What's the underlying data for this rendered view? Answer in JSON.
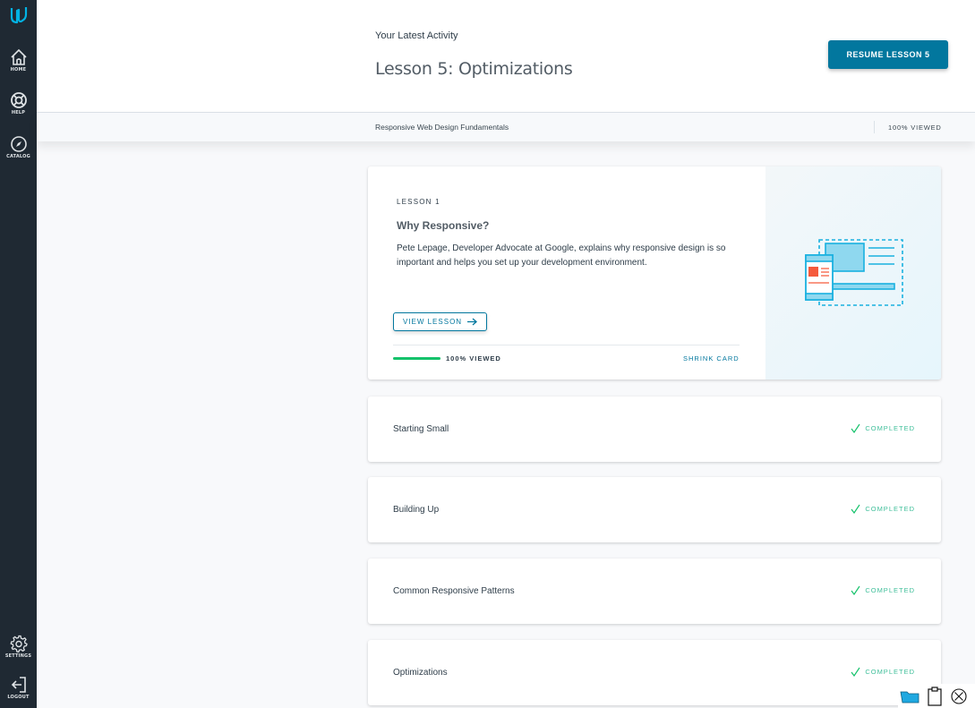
{
  "sidebar": {
    "logo": "udacity-logo-icon",
    "items": [
      {
        "label": "HOME",
        "icon": "home-icon"
      },
      {
        "label": "HELP",
        "icon": "lifebuoy-icon"
      },
      {
        "label": "CATALOG",
        "icon": "compass-icon"
      }
    ],
    "bottom_items": [
      {
        "label": "SETTINGS",
        "icon": "gear-icon"
      },
      {
        "label": "LOGOUT",
        "icon": "logout-icon"
      }
    ]
  },
  "header": {
    "latest_label": "Your Latest Activity",
    "lesson_title": "Lesson 5: Optimizations",
    "resume_button": "RESUME LESSON 5"
  },
  "subbar": {
    "course_name": "Responsive Web Design Fundamentals",
    "viewed": "100% VIEWED"
  },
  "featured_card": {
    "lesson_number": "LESSON 1",
    "title": "Why Responsive?",
    "description": "Pete Lepage, Developer Advocate at Google, explains why responsive design is so important and helps you set up your development environment.",
    "view_button": "VIEW LESSON",
    "progress_percent": 100,
    "viewed": "100% VIEWED",
    "shrink": "SHRINK CARD"
  },
  "lessons": [
    {
      "title": "Starting Small",
      "status": "COMPLETED"
    },
    {
      "title": "Building Up",
      "status": "COMPLETED"
    },
    {
      "title": "Common Responsive Patterns",
      "status": "COMPLETED"
    },
    {
      "title": "Optimizations",
      "status": "COMPLETED"
    }
  ],
  "colors": {
    "sidebar_bg": "#1f2933",
    "accent": "#02779e",
    "success": "#15c26b",
    "logo": "#02b3e4"
  },
  "tray": [
    "folder-icon",
    "clipboard-icon",
    "close-circle-icon"
  ]
}
